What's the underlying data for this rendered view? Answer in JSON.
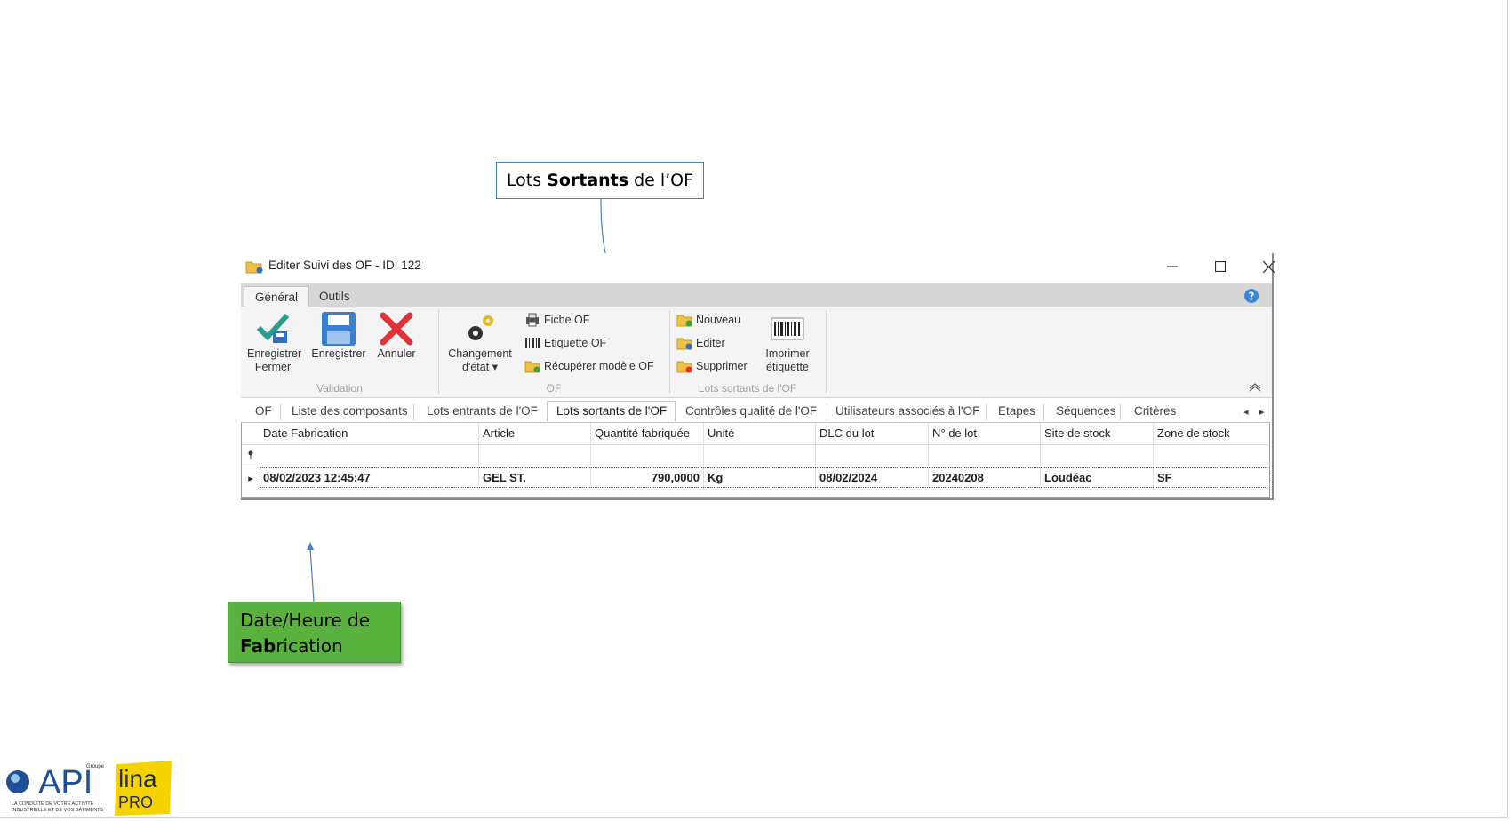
{
  "callouts": {
    "top": {
      "before": "Lots",
      "bold": "Sortants",
      "after": "de l’OF"
    },
    "bottom": {
      "line1": "Date/Heure de",
      "bold": "Fab",
      "rest": "rication"
    }
  },
  "window": {
    "title": "Editer Suivi des OF - ID: 122",
    "controls": {
      "minimize": "–",
      "maximize": "☐",
      "close": "✕"
    }
  },
  "ribbon_tabs": [
    "Général",
    "Outils"
  ],
  "ribbon": {
    "validation": {
      "label": "Validation",
      "save_close": [
        "Enregistrer",
        "Fermer"
      ],
      "save": "Enregistrer",
      "cancel": "Annuler"
    },
    "of": {
      "label": "OF",
      "change_state": [
        "Changement",
        "d'état"
      ],
      "fiche": "Fiche OF",
      "etiquette": "Etiquette OF",
      "recuperer": "Récupérer modèle OF"
    },
    "lots": {
      "label": "Lots sortants de l'OF",
      "nouveau": "Nouveau",
      "editer": "Editer",
      "supprimer": "Supprimer",
      "imprimer": [
        "Imprimer",
        "étiquette"
      ]
    }
  },
  "tabs": [
    "OF",
    "Liste des composants",
    "Lots entrants de l'OF",
    "Lots sortants de l'OF",
    "Contrôles qualité de l'OF",
    "Utilisateurs associés à l'OF",
    "Etapes",
    "Séquences",
    "Critères"
  ],
  "grid": {
    "columns": [
      "Date Fabrication",
      "Article",
      "Quantité fabriquée",
      "Unité",
      "DLC du lot",
      "N° de lot",
      "Site de stock",
      "Zone de stock"
    ],
    "rows": [
      [
        "08/02/2023 12:45:47",
        "GEL ST.",
        "790,0000",
        "Kg",
        "08/02/2024",
        "20240208",
        "Loudéac",
        "SF"
      ]
    ]
  },
  "logos": {
    "api_small": "Groupe",
    "api": "API",
    "api_tagline": [
      "LA CONDUITE DE VOTRE ACTIVITÉ",
      "INDUSTRIELLE ET DE VOS BÂTIMENTS"
    ],
    "lina": "lina",
    "pro": "PRO"
  }
}
